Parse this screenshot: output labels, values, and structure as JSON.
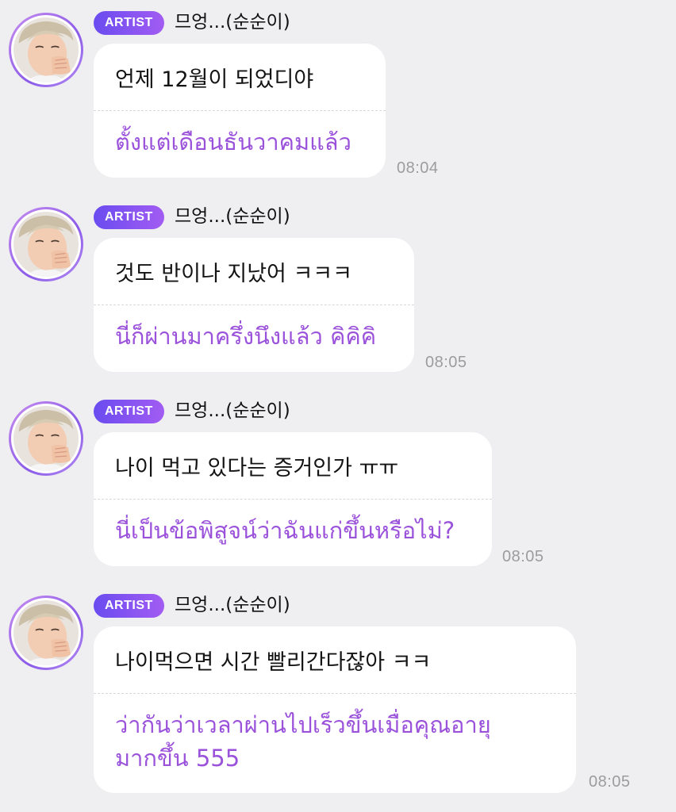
{
  "messages": [
    {
      "badge": "ARTIST",
      "sender": "므엉...(순순이)",
      "original": "언제 12월이 되었디야",
      "translation": "ตั้งแต่เดือนธันวาคมแล้ว",
      "time": "08:04"
    },
    {
      "badge": "ARTIST",
      "sender": "므엉...(순순이)",
      "original": "것도 반이나 지났어 ㅋㅋㅋ",
      "translation": "นี่ก็ผ่านมาครึ่งนึงแล้ว คิคิคิ",
      "time": "08:05"
    },
    {
      "badge": "ARTIST",
      "sender": "므엉...(순순이)",
      "original": "나이 먹고 있다는 증거인가 ㅠㅠ",
      "translation": "นี่เป็นข้อพิสูจน์ว่าฉันแก่ขึ้นหรือไม่?",
      "time": "08:05"
    },
    {
      "badge": "ARTIST",
      "sender": "므엉...(순순이)",
      "original": "나이먹으면 시간 빨리간다잖아 ㅋㅋ",
      "translation": "ว่ากันว่าเวลาผ่านไปเร็วขึ้นเมื่อคุณอายุมากขึ้น 555",
      "time": "08:05"
    }
  ],
  "colors": {
    "background": "#efeff1",
    "translation_text": "#9b52db",
    "badge_gradient_start": "#6a4cf0",
    "badge_gradient_end": "#a25cf2",
    "timestamp": "#9c9c9f"
  },
  "icons": {
    "avatar": "artist-profile-photo"
  }
}
